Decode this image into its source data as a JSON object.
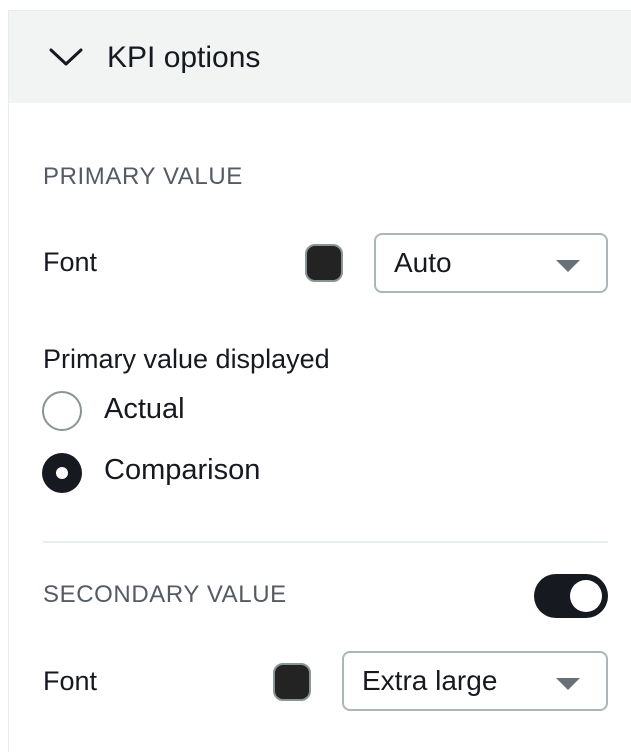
{
  "header": {
    "title": "KPI options",
    "expanded": true
  },
  "primary": {
    "section_label": "PRIMARY VALUE",
    "font_label": "Font",
    "font_color": "#232323",
    "font_size_value": "Auto",
    "displayed_label": "Primary value displayed",
    "options": [
      {
        "label": "Actual",
        "selected": false
      },
      {
        "label": "Comparison",
        "selected": true
      }
    ]
  },
  "secondary": {
    "section_label": "SECONDARY VALUE",
    "enabled": true,
    "font_label": "Font",
    "font_color": "#232323",
    "font_size_value": "Extra large"
  },
  "icons": {
    "header": "chevron-down-icon",
    "select": "caret-down-icon"
  }
}
